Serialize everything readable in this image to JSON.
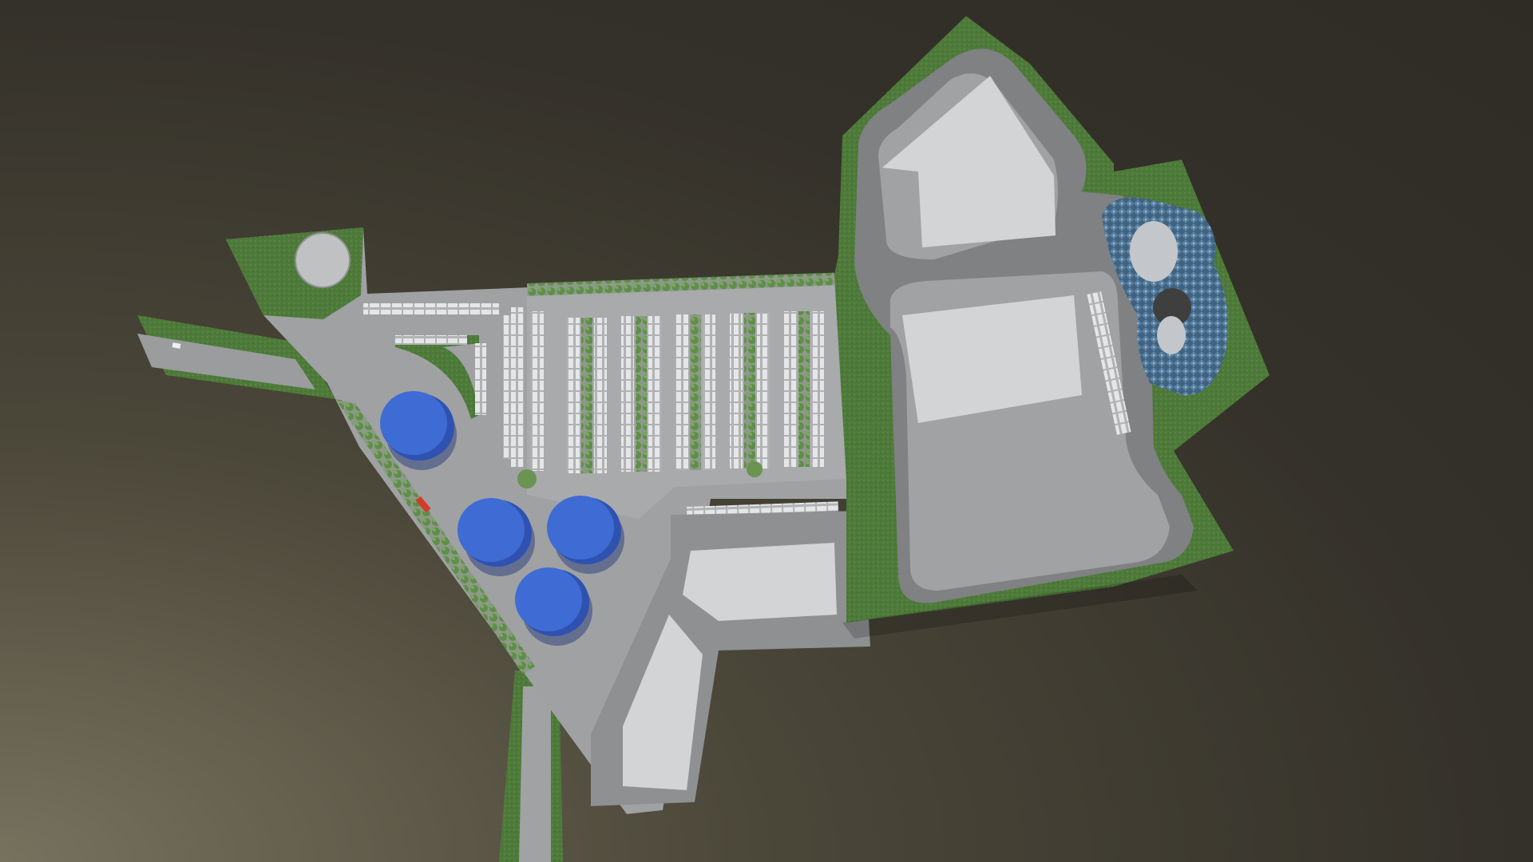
{
  "scene": {
    "description_visible_text": "",
    "colors": {
      "background_light": "#77725e",
      "background_dark": "#2f2c25",
      "grass": "#4e7a3a",
      "grass_dark": "#3e6630",
      "pavement": "#a6a8aa",
      "road": "#8a8c8e",
      "building_roof": "#d4d6d8",
      "tank_blue": "#3b63c9",
      "pond_water": "#4a6e8e",
      "accent_yellow": "#d6d64a",
      "accent_red": "#d23a2a"
    },
    "counts": {
      "blue_tanks": 4,
      "parking_tree_rows": 5,
      "large_buildings": 4
    }
  }
}
